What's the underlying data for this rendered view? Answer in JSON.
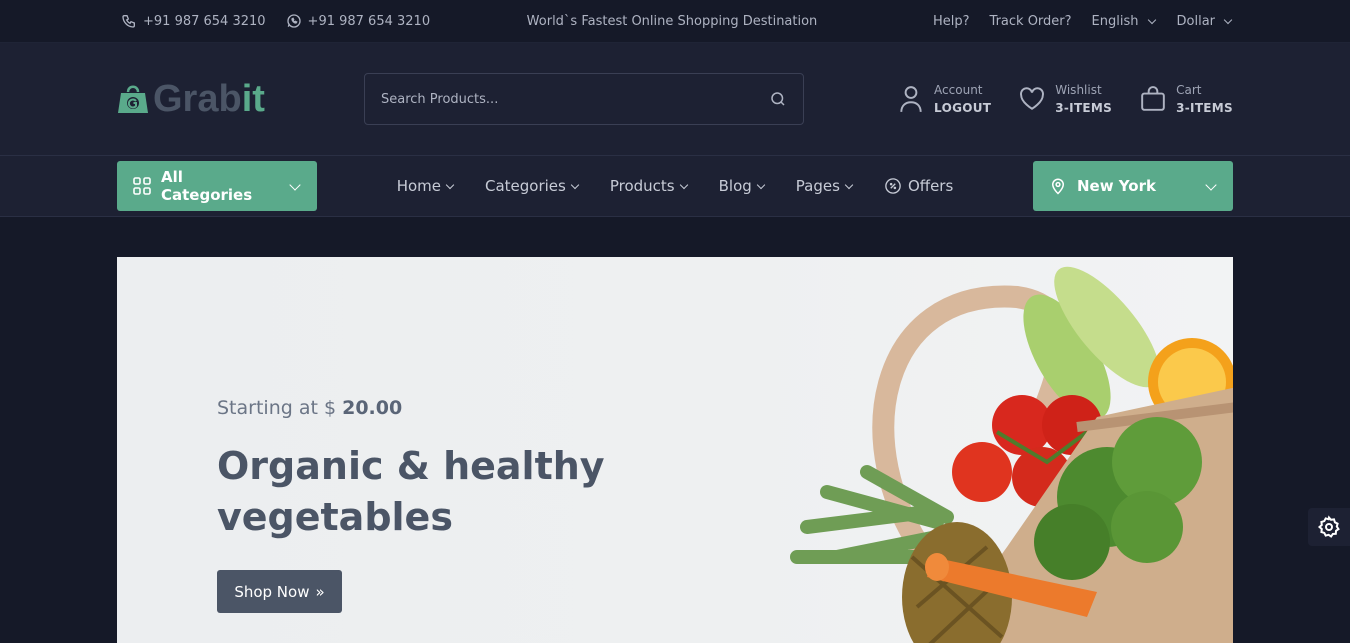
{
  "topbar": {
    "phone1": "+91 987 654 3210",
    "phone2": "+91 987 654 3210",
    "tagline": "World`s Fastest Online Shopping Destination",
    "help": "Help?",
    "track": "Track Order?",
    "language": "English",
    "currency": "Dollar"
  },
  "header": {
    "logo_part1": "Grab",
    "logo_part2": "it",
    "search_placeholder": "Search Products...",
    "account_label": "Account",
    "account_value": "LOGOUT",
    "wishlist_label": "Wishlist",
    "wishlist_value": "3-ITEMS",
    "cart_label": "Cart",
    "cart_value": "3-ITEMS"
  },
  "nav": {
    "all_categories": "All Categories",
    "menu": [
      "Home",
      "Categories",
      "Products",
      "Blog",
      "Pages",
      "Offers"
    ],
    "location": "New York"
  },
  "hero": {
    "sub_prefix": "Starting at $ ",
    "price": "20.00",
    "title": "Organic & healthy vegetables",
    "button": "Shop Now"
  },
  "colors": {
    "accent": "#5aaa8b",
    "dark_bg": "#151928",
    "header_bg": "#1d2133",
    "heading": "#4b5566"
  },
  "icons": [
    "phone-icon",
    "whatsapp-icon",
    "search-icon",
    "user-icon",
    "heart-icon",
    "bag-icon",
    "grid-icon",
    "map-pin-icon",
    "offer-badge-icon",
    "gear-icon"
  ]
}
